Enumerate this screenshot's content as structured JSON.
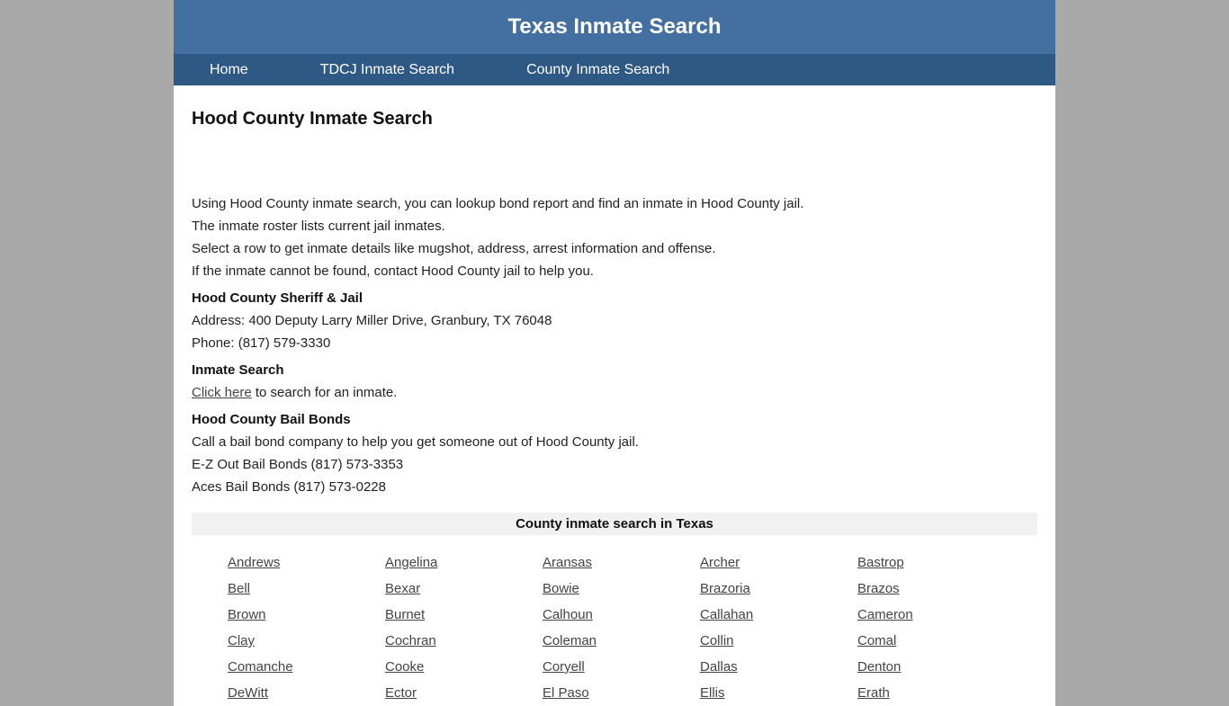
{
  "header": {
    "site_title": "Texas Inmate Search"
  },
  "nav": {
    "items": [
      {
        "label": "Home"
      },
      {
        "label": "TDCJ Inmate Search"
      },
      {
        "label": "County Inmate Search"
      }
    ]
  },
  "main": {
    "title": "Hood County Inmate Search",
    "intro": [
      "Using Hood County inmate search, you can lookup bond report and find an inmate in Hood County jail.",
      "The inmate roster lists current jail inmates.",
      "Select a row to get inmate details like mugshot, address, arrest information and offense.",
      "If the inmate cannot be found, contact Hood County jail to help you."
    ],
    "sheriff": {
      "heading": "Hood County Sheriff & Jail",
      "address": "Address: 400 Deputy Larry Miller Drive, Granbury, TX 76048",
      "phone": "Phone: (817) 579-3330"
    },
    "inmate_search": {
      "heading": "Inmate Search",
      "link_label": "Click here",
      "link_suffix": " to search for an inmate."
    },
    "bail_bonds": {
      "heading": "Hood County Bail Bonds",
      "description": "Call a bail bond company to help you get someone out of Hood County jail.",
      "companies": [
        "E-Z Out Bail Bonds (817) 573-3353",
        "Aces Bail Bonds (817) 573-0228"
      ]
    },
    "counties": {
      "heading": "County inmate search in Texas",
      "items": [
        "Andrews",
        "Angelina",
        "Aransas",
        "Archer",
        "Bastrop",
        "Bell",
        "Bexar",
        "Bowie",
        "Brazoria",
        "Brazos",
        "Brown",
        "Burnet",
        "Calhoun",
        "Callahan",
        "Cameron",
        "Clay",
        "Cochran",
        "Coleman",
        "Collin",
        "Comal",
        "Comanche",
        "Cooke",
        "Coryell",
        "Dallas",
        "Denton",
        "DeWitt",
        "Ector",
        "El Paso",
        "Ellis",
        "Erath"
      ]
    }
  },
  "colors": {
    "header_bg": "#4370a0",
    "nav_bg": "#2f5985",
    "page_bg": "#a9a9a9",
    "county_header_bg": "#f1f1f1"
  }
}
